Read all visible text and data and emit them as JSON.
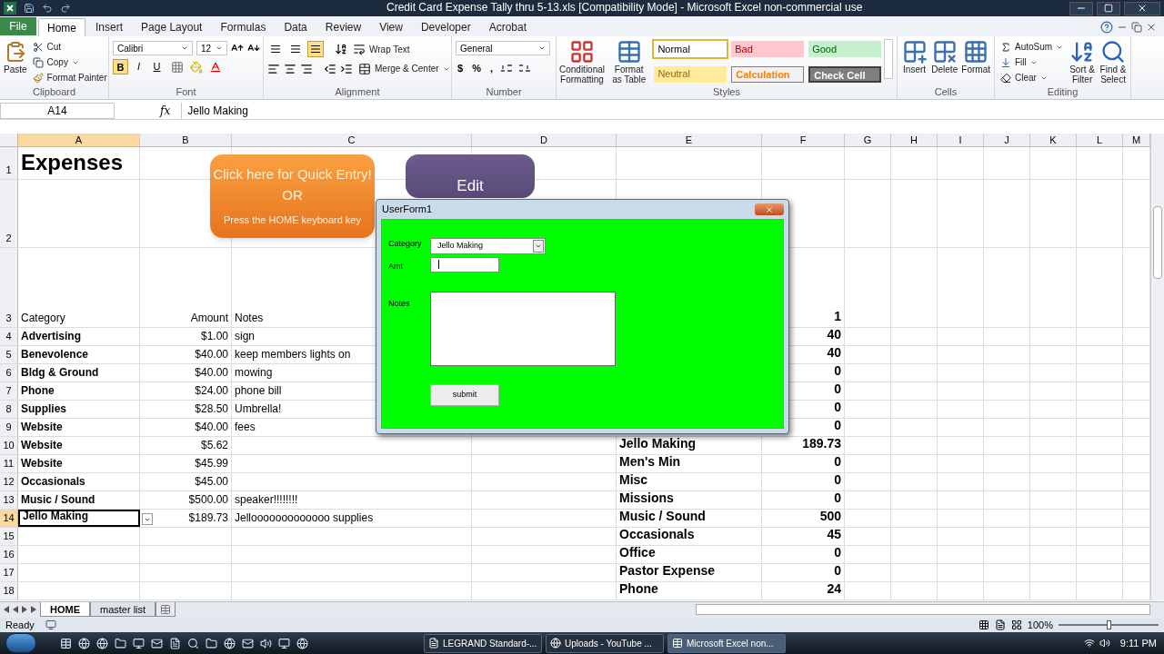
{
  "window": {
    "title": "Credit Card Expense Tally thru 5-13.xls  [Compatibility Mode]  -  Microsoft Excel non-commercial use"
  },
  "ribbon_tabs": [
    {
      "label": "File",
      "kind": "file",
      "selected": false
    },
    {
      "label": "Home",
      "kind": "tab",
      "selected": true
    },
    {
      "label": "Insert",
      "kind": "tab",
      "selected": false
    },
    {
      "label": "Page Layout",
      "kind": "tab",
      "selected": false
    },
    {
      "label": "Formulas",
      "kind": "tab",
      "selected": false
    },
    {
      "label": "Data",
      "kind": "tab",
      "selected": false
    },
    {
      "label": "Review",
      "kind": "tab",
      "selected": false
    },
    {
      "label": "View",
      "kind": "tab",
      "selected": false
    },
    {
      "label": "Developer",
      "kind": "tab",
      "selected": false
    },
    {
      "label": "Acrobat",
      "kind": "tab",
      "selected": false
    }
  ],
  "clipboard": {
    "paste": "Paste",
    "cut": "Cut",
    "copy": "Copy",
    "format_painter": "Format Painter",
    "label": "Clipboard"
  },
  "font": {
    "name": "Calibri",
    "size": "12",
    "label": "Font",
    "styles": [
      {
        "label": "B",
        "selected": true
      },
      {
        "label": "I",
        "selected": false
      },
      {
        "label": "U",
        "selected": false
      }
    ]
  },
  "alignment": {
    "wrap_text": "Wrap Text",
    "merge_center": "Merge & Center",
    "label": "Alignment",
    "vertical": [
      {
        "selected": false
      },
      {
        "selected": false
      },
      {
        "selected": true
      }
    ]
  },
  "number": {
    "format": "General",
    "symbols": [
      "$",
      "%",
      ","
    ],
    "label": "Number"
  },
  "styles": {
    "conditional_formatting": [
      "Conditional",
      "Formatting"
    ],
    "format_as_table": [
      "Format",
      "as Table"
    ],
    "label": "Styles",
    "cells": [
      {
        "label": "Normal",
        "kind": "normal",
        "selected": true
      },
      {
        "label": "Bad",
        "kind": "bad",
        "selected": false
      },
      {
        "label": "Good",
        "kind": "good",
        "selected": false
      },
      {
        "label": "Neutral",
        "kind": "neutral",
        "selected": false
      },
      {
        "label": "Calculation",
        "kind": "calculation",
        "selected": false
      },
      {
        "label": "Check Cell",
        "kind": "check",
        "selected": false
      }
    ]
  },
  "cells": {
    "buttons": [
      "Insert",
      "Delete",
      "Format"
    ],
    "label": "Cells"
  },
  "editing": {
    "autosum": "AutoSum",
    "fill": "Fill",
    "clear": "Clear",
    "sort_filter": [
      "Sort &",
      "Filter"
    ],
    "find_select": [
      "Find &",
      "Select"
    ],
    "label": "Editing"
  },
  "formula_bar": {
    "name_box": "A14",
    "function_label": "fx",
    "content": "Jello Making"
  },
  "columns": [
    {
      "label": "A",
      "selected": true
    },
    {
      "label": "B",
      "selected": false
    },
    {
      "label": "C",
      "selected": false
    },
    {
      "label": "D",
      "selected": false
    },
    {
      "label": "E",
      "selected": false
    },
    {
      "label": "F",
      "selected": false
    },
    {
      "label": "G",
      "selected": false
    },
    {
      "label": "H",
      "selected": false
    },
    {
      "label": "I",
      "selected": false
    },
    {
      "label": "J",
      "selected": false
    },
    {
      "label": "K",
      "selected": false
    },
    {
      "label": "L",
      "selected": false
    },
    {
      "label": "M",
      "selected": false
    }
  ],
  "rows": [
    {
      "number": "1",
      "kind": "title",
      "selected": false,
      "a": "Expenses"
    },
    {
      "number": "2",
      "kind": "blank",
      "selected": false
    },
    {
      "number": "3",
      "kind": "header",
      "selected": false,
      "a": "Category",
      "b": "Amount",
      "c": "Notes",
      "f": "1"
    },
    {
      "number": "4",
      "kind": "entry",
      "selected": false,
      "a": "Advertising",
      "b": "$1.00",
      "c": "sign",
      "f": "40"
    },
    {
      "number": "5",
      "kind": "entry",
      "selected": false,
      "a": "Benevolence",
      "b": "$40.00",
      "c": "keep members lights on",
      "f": "40"
    },
    {
      "number": "6",
      "kind": "entry",
      "selected": false,
      "a": "Bldg & Ground",
      "b": "$40.00",
      "c": "mowing",
      "f": "0"
    },
    {
      "number": "7",
      "kind": "entry",
      "selected": false,
      "a": "Phone",
      "b": "$24.00",
      "c": "phone bill",
      "f": "0"
    },
    {
      "number": "8",
      "kind": "entry",
      "selected": false,
      "a": "Supplies",
      "b": "$28.50",
      "c": "Umbrella!",
      "f": "0"
    },
    {
      "number": "9",
      "kind": "entry",
      "selected": false,
      "a": "Website",
      "b": "$40.00",
      "c": "fees",
      "f": "0"
    },
    {
      "number": "10",
      "kind": "entry",
      "selected": false,
      "a": "Website",
      "b": "$5.62",
      "e": "Jello Making",
      "f": "189.73"
    },
    {
      "number": "11",
      "kind": "entry",
      "selected": false,
      "a": "Website",
      "b": "$45.99",
      "e": "Men's Min",
      "f": "0"
    },
    {
      "number": "12",
      "kind": "entry",
      "selected": false,
      "a": "Occasionals",
      "b": "$45.00",
      "e": "Misc",
      "f": "0"
    },
    {
      "number": "13",
      "kind": "entry",
      "selected": false,
      "a": "Music / Sound",
      "b": "$500.00",
      "c": "speaker!!!!!!!!",
      "e": "Missions",
      "f": "0"
    },
    {
      "number": "14",
      "kind": "entry",
      "selected": true,
      "a": "Jello Making",
      "b": "$189.73",
      "c": "Jellooooooooooooo supplies",
      "e": "Music / Sound",
      "f": "500"
    },
    {
      "number": "15",
      "kind": "entry",
      "selected": false,
      "e": "Occasionals",
      "f": "45"
    },
    {
      "number": "16",
      "kind": "entry",
      "selected": false,
      "e": "Office",
      "f": "0"
    },
    {
      "number": "17",
      "kind": "entry",
      "selected": false,
      "e": "Pastor Expense",
      "f": "0"
    },
    {
      "number": "18",
      "kind": "entry",
      "selected": false,
      "e": "Phone",
      "f": "24"
    }
  ],
  "quick_entry_shape": {
    "lines": [
      "Click here for Quick Entry!",
      "OR",
      "Press the HOME keyboard key"
    ]
  },
  "edit_shape": {
    "label": "Edit"
  },
  "userform": {
    "title": "UserForm1",
    "category_label": "Category",
    "category_value": "Jello Making",
    "amt_label": "Amt",
    "notes_label": "Notes",
    "submit": "submit"
  },
  "sheet_tabs": [
    {
      "label": "HOME",
      "selected": true
    },
    {
      "label": "master list",
      "selected": false
    }
  ],
  "status_bar": {
    "status": "Ready",
    "zoom": "100%",
    "zoom_slider": {
      "level": 0.5
    }
  },
  "taskbar": {
    "clock": "9:11 PM",
    "windows": [
      {
        "label": "LEGRAND Standard-...",
        "kind": "pdf",
        "selected": false
      },
      {
        "label": "Uploads - YouTube ...",
        "kind": "browser",
        "selected": false
      },
      {
        "label": "Microsoft Excel non...",
        "kind": "excel",
        "selected": true
      }
    ]
  }
}
